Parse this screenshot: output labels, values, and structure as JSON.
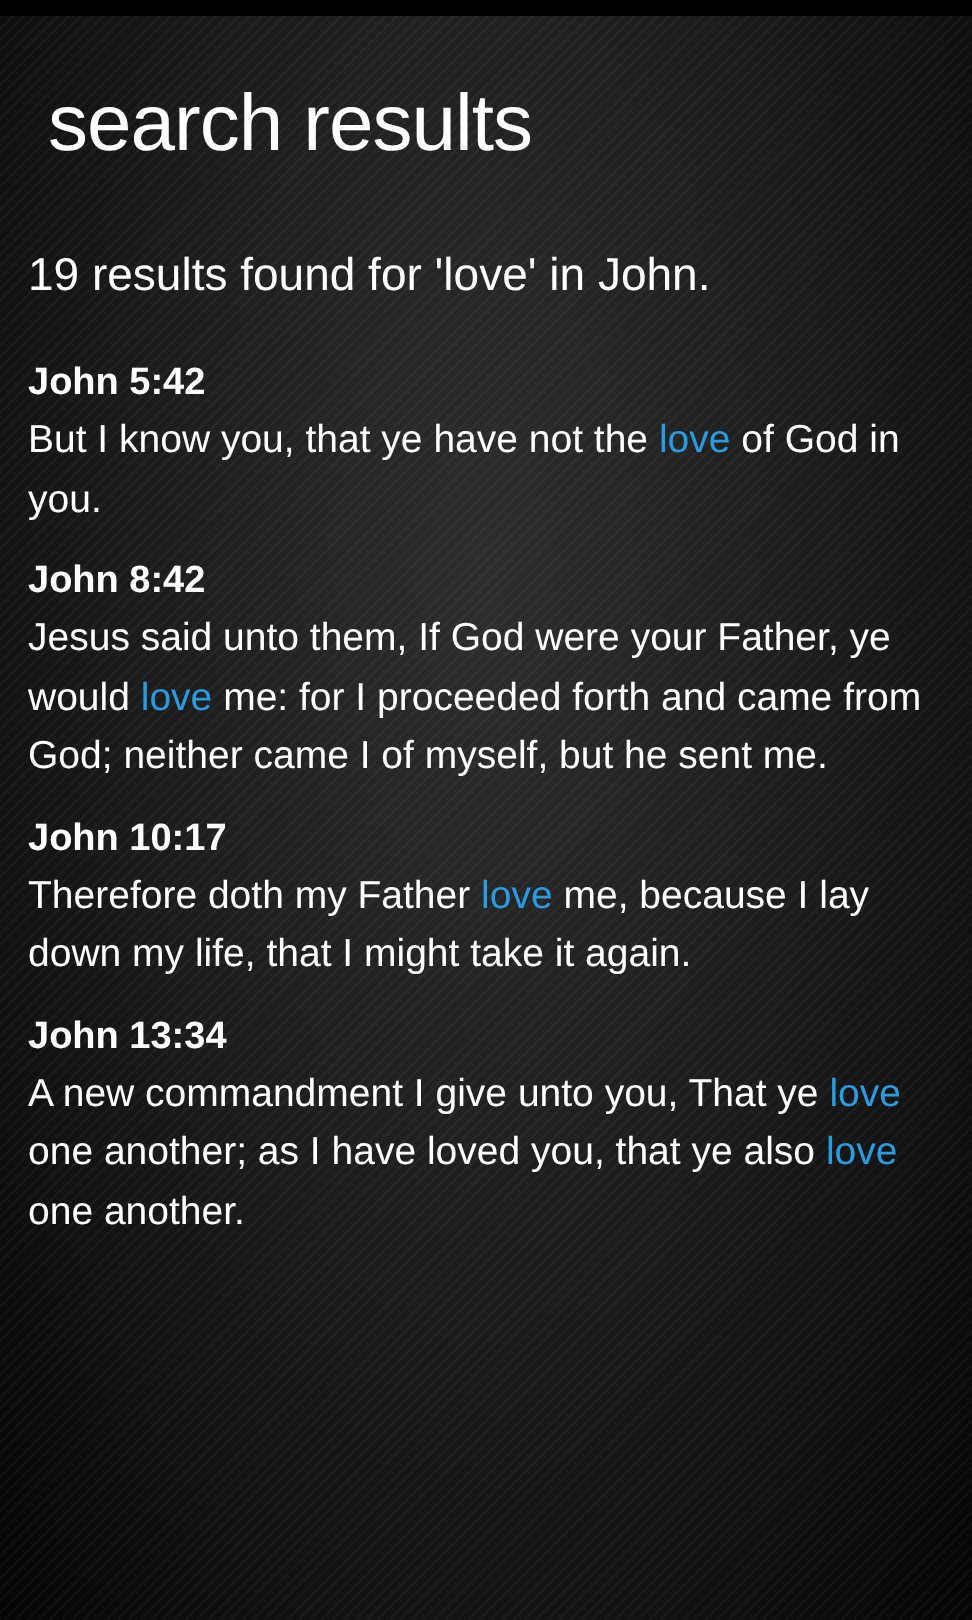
{
  "title": "search results",
  "summary": "19 results found for 'love' in John.",
  "results": [
    {
      "reference": "John 5:42",
      "segments": [
        {
          "text": "But I know you, that ye have not the ",
          "highlight": false
        },
        {
          "text": "love",
          "highlight": true
        },
        {
          "text": " of God in you.",
          "highlight": false
        }
      ]
    },
    {
      "reference": "John 8:42",
      "segments": [
        {
          "text": "Jesus said unto them, If God were your Father, ye would ",
          "highlight": false
        },
        {
          "text": "love",
          "highlight": true
        },
        {
          "text": " me: for I proceeded forth and came from God; neither came I of myself, but he sent me.",
          "highlight": false
        }
      ]
    },
    {
      "reference": "John 10:17",
      "segments": [
        {
          "text": "Therefore doth my Father ",
          "highlight": false
        },
        {
          "text": "love",
          "highlight": true
        },
        {
          "text": " me, because I lay down my life, that I might take it again.",
          "highlight": false
        }
      ]
    },
    {
      "reference": "John 13:34",
      "segments": [
        {
          "text": "A new commandment I give unto you, That ye ",
          "highlight": false
        },
        {
          "text": "love",
          "highlight": true
        },
        {
          "text": " one another; as I have loved you, that ye also ",
          "highlight": false
        },
        {
          "text": "love",
          "highlight": true
        },
        {
          "text": " one another.",
          "highlight": false
        }
      ]
    }
  ]
}
